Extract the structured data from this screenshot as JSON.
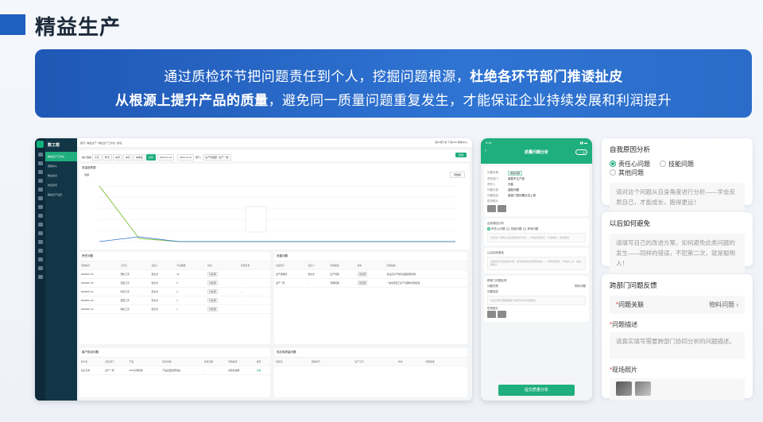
{
  "header": {
    "title": "精益生产"
  },
  "banner": {
    "line1_normal": "通过质检环节把问题责任到个人，挖掘问题根源，",
    "line1_bold": "杜绝各环节部门推诿扯皮",
    "line2_bold": "从根源上提升产品的质量",
    "line2_normal": "，避免同一质量问题重复发生，才能保证企业持续发展和利润提升"
  },
  "desktop": {
    "brand": "数工帮",
    "nav": [
      "精益生产工作台",
      "质量中心",
      "精益改善",
      "供应协同",
      "精益生产设置"
    ],
    "breadcrumb": "首页 / 精益生产 / 精益生产工作台 / 报表",
    "top_right": "客户端下载   下载APP   帮助中心",
    "filter_label": "统计维度",
    "chips": [
      "今天",
      "昨天",
      "本周",
      "本月",
      "本季度",
      "全年"
    ],
    "active_chip": "全年",
    "date_from": "2022-01-01",
    "date_to": "2022-12-31",
    "dept_label": "部门：",
    "dept_value": "生产管理部 / 生产一部",
    "query_btn": "查询",
    "chart_title": "质量趋势图",
    "chart_sub": "问题",
    "chart_select": "周维度",
    "panel1": {
      "title": "责任问题",
      "cols": [
        "问题编号",
        "工序名",
        "责任人",
        "不良数量",
        "状态",
        "原因分析"
      ],
      "rows": [
        [
          "R220407-46",
          "预检工序",
          "张文杰",
          "10",
          "待处理",
          "-"
        ],
        [
          "R220407-45",
          "包装工序",
          "张文杰",
          "5",
          "待处理",
          "-"
        ],
        [
          "R220407-44",
          "喷漆工序",
          "张文杰",
          "2",
          "待处理",
          "-"
        ],
        [
          "R220407-43",
          "装配工序",
          "张文杰",
          "3",
          "待处理",
          "-"
        ],
        [
          "R220407-42",
          "焊接工序",
          "张文杰",
          "1",
          "待处理",
          "-"
        ]
      ]
    },
    "panel2": {
      "title": "改善问题",
      "cols": [
        "责任部门",
        "责任人",
        "问题类型",
        "状态",
        "问题描述"
      ],
      "rows": [
        [
          "生产管理部",
          "张文杰",
          "生产问题",
          "待处理",
          "请注意对于零件表面划伤问题"
        ],
        [
          "生产一部",
          "-",
          "管理问题",
          "待处理",
          "一些出现员工生产过程中问题反馈"
        ]
      ]
    },
    "panel3": {
      "title": "客户投诉问题",
      "cols": [
        "客户名",
        "责任部门",
        "产品",
        "投诉内容",
        "投诉日期",
        "问题描述",
        "操作"
      ],
      "rows": [
        [
          "昆仑五金",
          "生产一部",
          "CRS空调机组",
          "产品表面出现划痕",
          "-",
          "请及时处理",
          "查看"
        ]
      ]
    },
    "panel4": {
      "title": "供应商质量问题",
      "cols": [
        "供应商",
        "采购单号",
        "生产工序",
        "状态",
        "问题描述"
      ]
    }
  },
  "mobile": {
    "time": "9:41",
    "title": "质量问题分析",
    "fields": [
      {
        "k": "问题来源",
        "v": "质检问题"
      },
      {
        "k": "责任部门",
        "v": "装配车生产部"
      },
      {
        "k": "责任人",
        "v": "刘星"
      },
      {
        "k": "问题分类",
        "v": "装配问题"
      },
      {
        "k": "问题描述",
        "v": "组装门把的螺丝没上紧"
      },
      {
        "k": "现场照片",
        "v": ""
      }
    ],
    "cause_title": "自我原因分析",
    "cause_opts": [
      "责任心问题",
      "技能问题",
      "其他问题"
    ],
    "cause_ph": "请对这个问题从自身角度进行分析——学会反思自己，才能成长，跑得更远",
    "avoid_title": "以后如何避免",
    "avoid_ph": "请填写自己的改进方案，如何避免此类问题的发生——同样的错误，不犯第二次，就是聪明人",
    "dept_title": "跨部门问题反馈",
    "link_label": "问题关联",
    "link_value": "物料问题",
    "desc_label": "问题描述",
    "desc_ph": "请在实填写需要跨部门协同分析的问题描述",
    "photo_label": "现场照片",
    "submit": "提交质量分析"
  },
  "cards": {
    "self": {
      "title": "自我原因分析",
      "opts": [
        "责任心问题",
        "技能问题",
        "其他问题"
      ],
      "active": "责任心问题",
      "placeholder": "请对这个问题从自身角度进行分析——学会反思自己，才能成长，跑得更远！"
    },
    "avoid": {
      "title": "以后如何避免",
      "placeholder": "请填写自己的改进方案，如何避免此类问题的发生——同样的错误，不犯第二次，就是聪明人！"
    },
    "cross": {
      "title": "跨部门问题反馈",
      "link_label": "问题关联",
      "link_value": "物料问题",
      "desc_label": "问题描述",
      "desc_placeholder": "请真实填写需要跨部门协同分析的问题描述。",
      "photo_label": "现场照片"
    }
  }
}
